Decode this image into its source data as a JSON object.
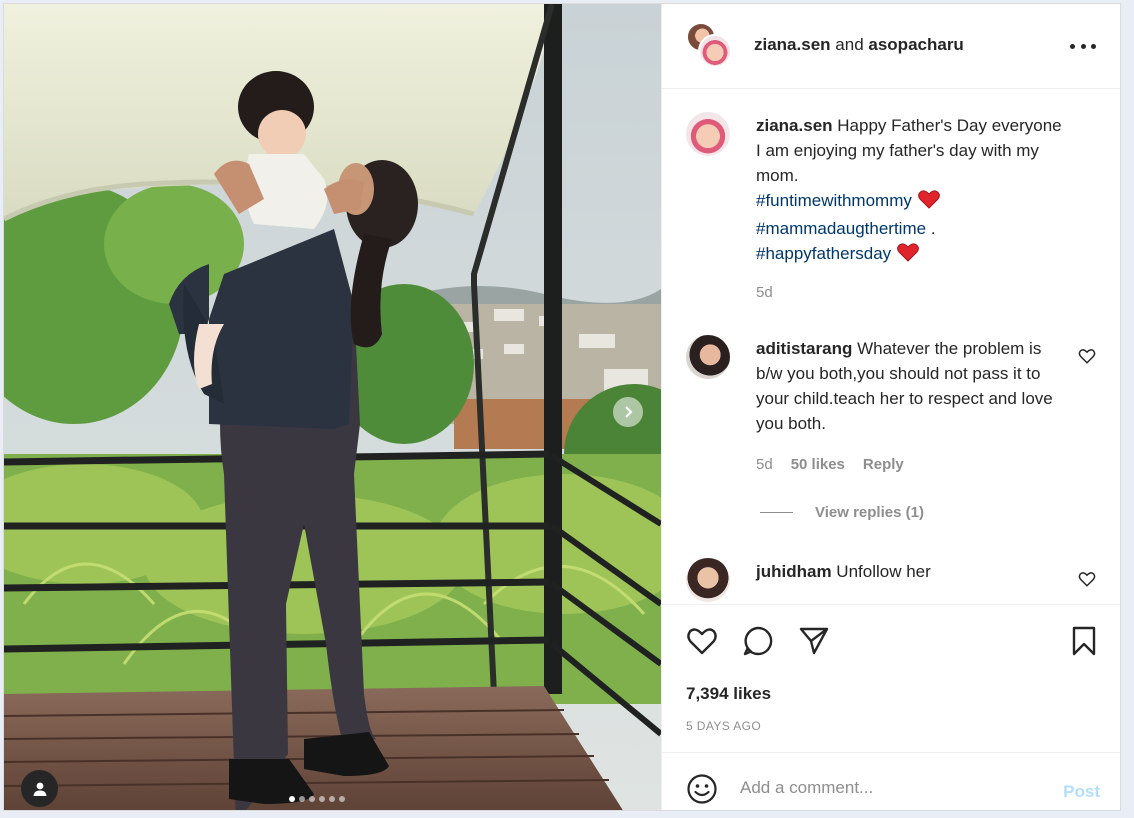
{
  "post": {
    "header": {
      "author": "ziana.sen",
      "joiner": "and",
      "collaborator": "asopacharu",
      "more_icon": "more-horizontal-icon"
    },
    "caption": {
      "user": "ziana.sen",
      "text_line": "Happy Father's Day everyone I am enjoying my father's day with my mom.",
      "tags": [
        "#funtimewithmommy",
        "#mammadaugthertime",
        "#happyfathersday"
      ],
      "tag_separator": ".",
      "emoji": "red-heart",
      "time": "5d"
    },
    "comments": [
      {
        "user": "aditistarang",
        "text": "Whatever the problem is b/w you both,you should not pass it to your child.teach her to respect and love you both.",
        "time": "5d",
        "likes": "50 likes",
        "reply_label": "Reply",
        "view_replies": "View replies (1)"
      },
      {
        "user": "juhidham",
        "text": "Unfollow her"
      }
    ],
    "likes_count": "7,394 likes",
    "posted_ago": "5 DAYS AGO",
    "add_comment": {
      "placeholder": "Add a comment...",
      "post_label": "Post"
    },
    "carousel": {
      "total_slides": 6,
      "current_slide": 1
    }
  },
  "icons": {
    "like": "heart-outline-icon",
    "comment": "comment-bubble-icon",
    "share": "paper-plane-icon",
    "save": "bookmark-icon",
    "emoji": "smiley-icon",
    "user_tag": "person-icon",
    "next": "chevron-right-icon"
  },
  "colors": {
    "link_blue": "#00376b",
    "post_disabled": "#b2dffc",
    "secondary_text": "#8e8e8e",
    "heart_red": "#ed4956"
  }
}
